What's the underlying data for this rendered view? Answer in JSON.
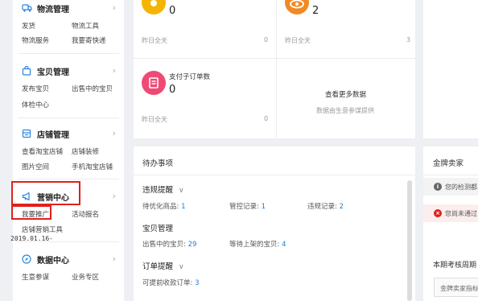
{
  "sidebar": {
    "logistics": {
      "title": "物流管理",
      "links": [
        "发货",
        "物流工具",
        "物流服务",
        "我要寄快递"
      ]
    },
    "baby": {
      "title": "宝贝管理",
      "links": [
        "发布宝贝",
        "出售中的宝贝",
        "体检中心"
      ]
    },
    "shop": {
      "title": "店铺管理",
      "links": [
        "查看淘宝店铺",
        "店铺装修",
        "图片空间",
        "手机淘宝店铺"
      ]
    },
    "marketing": {
      "title": "营销中心",
      "links": [
        "我要推广",
        "活动报名",
        "店铺营销工具"
      ]
    },
    "data": {
      "title": "数据中心",
      "links": [
        "生意参谋",
        "业务专区"
      ]
    },
    "chevron": "›"
  },
  "stats": {
    "cell1": {
      "value": "0",
      "foot": "昨日全天",
      "num": "0"
    },
    "cell2": {
      "value": "2",
      "foot": "昨日全天",
      "num": "3"
    },
    "cell3": {
      "label": "支付子订单数",
      "value": "0",
      "foot": "昨日全天",
      "num": "0"
    },
    "more": {
      "title": "查看更多数据",
      "sub": "数据由生意参谋提供"
    }
  },
  "todo": {
    "title": "待办事项",
    "violation": {
      "title": "违规提醒",
      "chevron": "∨",
      "items": [
        {
          "label": "待优化商品: ",
          "count": "1"
        },
        {
          "label": "管控记录: ",
          "count": "1"
        },
        {
          "label": "违规记录: ",
          "count": "2"
        }
      ]
    },
    "baby": {
      "title": "宝贝管理",
      "items": [
        {
          "label": "出售中的宝贝: ",
          "count": "29"
        },
        {
          "label": "等待上架的宝贝: ",
          "count": "4"
        }
      ]
    },
    "order": {
      "title": "订单提醒",
      "chevron": "∨",
      "items": [
        {
          "label": "可提前收款订单: ",
          "count": "3"
        }
      ]
    }
  },
  "gold": {
    "title": "金牌卖家",
    "row1": "您的检测都",
    "row2": "您尚未通过",
    "date": "2019.01.16-",
    "period": "本期考核周期",
    "box": "金牌卖家指标"
  },
  "colors": {
    "accent_blue": "#1a7cd9",
    "highlight_red": "#e0201b",
    "orange": "#f08a24",
    "yellow": "#f5b400",
    "pink": "#ef4a76"
  }
}
